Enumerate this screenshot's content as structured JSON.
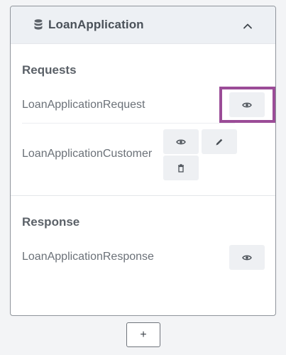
{
  "panel": {
    "title": "LoanApplication",
    "title_icon": "database-icon",
    "collapse_icon": "chevron-up-icon"
  },
  "requests": {
    "heading": "Requests",
    "items": [
      {
        "label": "LoanApplicationRequest",
        "actions": [
          "eye-icon"
        ]
      },
      {
        "label": "LoanApplicationCustomer",
        "actions": [
          "eye-icon",
          "pencil-icon",
          "trash-icon"
        ]
      }
    ]
  },
  "response": {
    "heading": "Response",
    "items": [
      {
        "label": "LoanApplicationResponse",
        "actions": [
          "eye-icon"
        ]
      }
    ]
  },
  "footer": {
    "add_label": "+"
  },
  "colors": {
    "highlight": "#9b4c97",
    "header_bg": "#edf0f4",
    "button_bg": "#eef0f3"
  }
}
